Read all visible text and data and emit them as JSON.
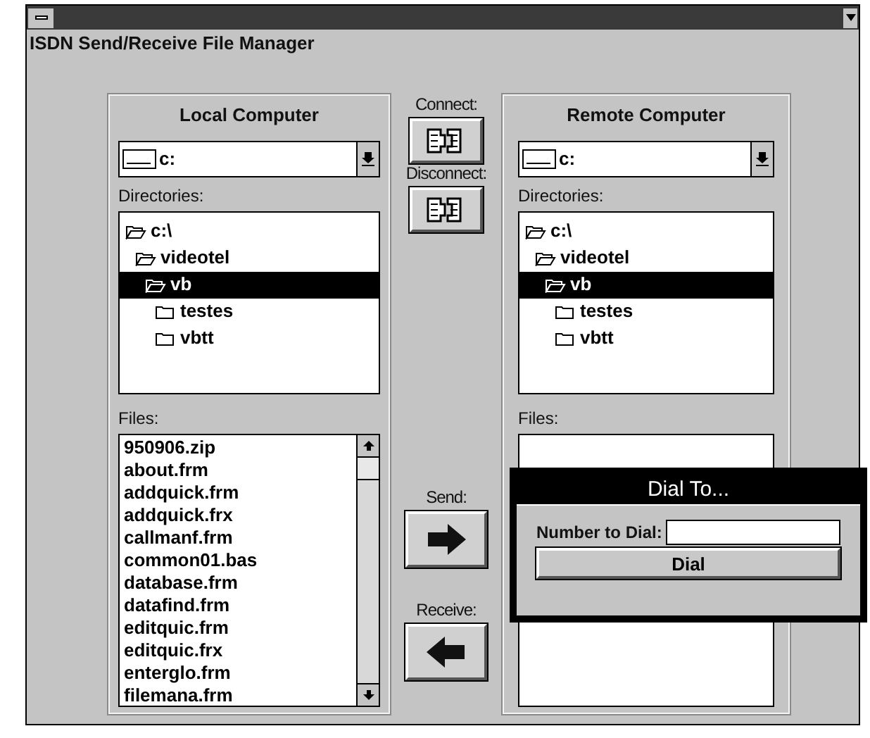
{
  "window": {
    "subtitle": "ISDN Send/Receive File Manager"
  },
  "local": {
    "heading": "Local Computer",
    "drive": "c:",
    "directories_label": "Directories:",
    "directories": [
      {
        "name": "c:\\",
        "expanded": true,
        "selected": false,
        "children": [
          {
            "name": "videotel",
            "expanded": true,
            "selected": false,
            "children": [
              {
                "name": "vb",
                "expanded": true,
                "selected": true,
                "children": [
                  {
                    "name": "testes",
                    "expanded": false,
                    "selected": false
                  },
                  {
                    "name": "vbtt",
                    "expanded": false,
                    "selected": false
                  }
                ]
              }
            ]
          }
        ]
      }
    ],
    "files_label": "Files:",
    "files": [
      "950906.zip",
      "about.frm",
      "addquick.frm",
      "addquick.frx",
      "callmanf.frm",
      "common01.bas",
      "database.frm",
      "datafind.frm",
      "editquic.frm",
      "editquic.frx",
      "enterglo.frm",
      "filemana.frm"
    ]
  },
  "actions": [
    {
      "label": "Connect:",
      "kind": "plug"
    },
    {
      "label": "Disconnect:",
      "kind": "plug"
    },
    {
      "label": "Send:",
      "kind": "send"
    },
    {
      "label": "Receive:",
      "kind": "receive"
    }
  ],
  "remote": {
    "heading": "Remote Computer",
    "drive": "c:",
    "directories_label": "Directories:",
    "directories": [
      {
        "name": "c:\\",
        "expanded": true,
        "selected": false,
        "children": [
          {
            "name": "videotel",
            "expanded": true,
            "selected": false,
            "children": [
              {
                "name": "vb",
                "expanded": true,
                "selected": true,
                "children": [
                  {
                    "name": "testes",
                    "expanded": false,
                    "selected": false
                  },
                  {
                    "name": "vbtt",
                    "expanded": false,
                    "selected": false
                  }
                ]
              }
            ]
          }
        ]
      }
    ],
    "files_label": "Files:"
  },
  "dialog": {
    "title": "Dial To...",
    "field_label": "Number to Dial:",
    "button": "Dial"
  }
}
